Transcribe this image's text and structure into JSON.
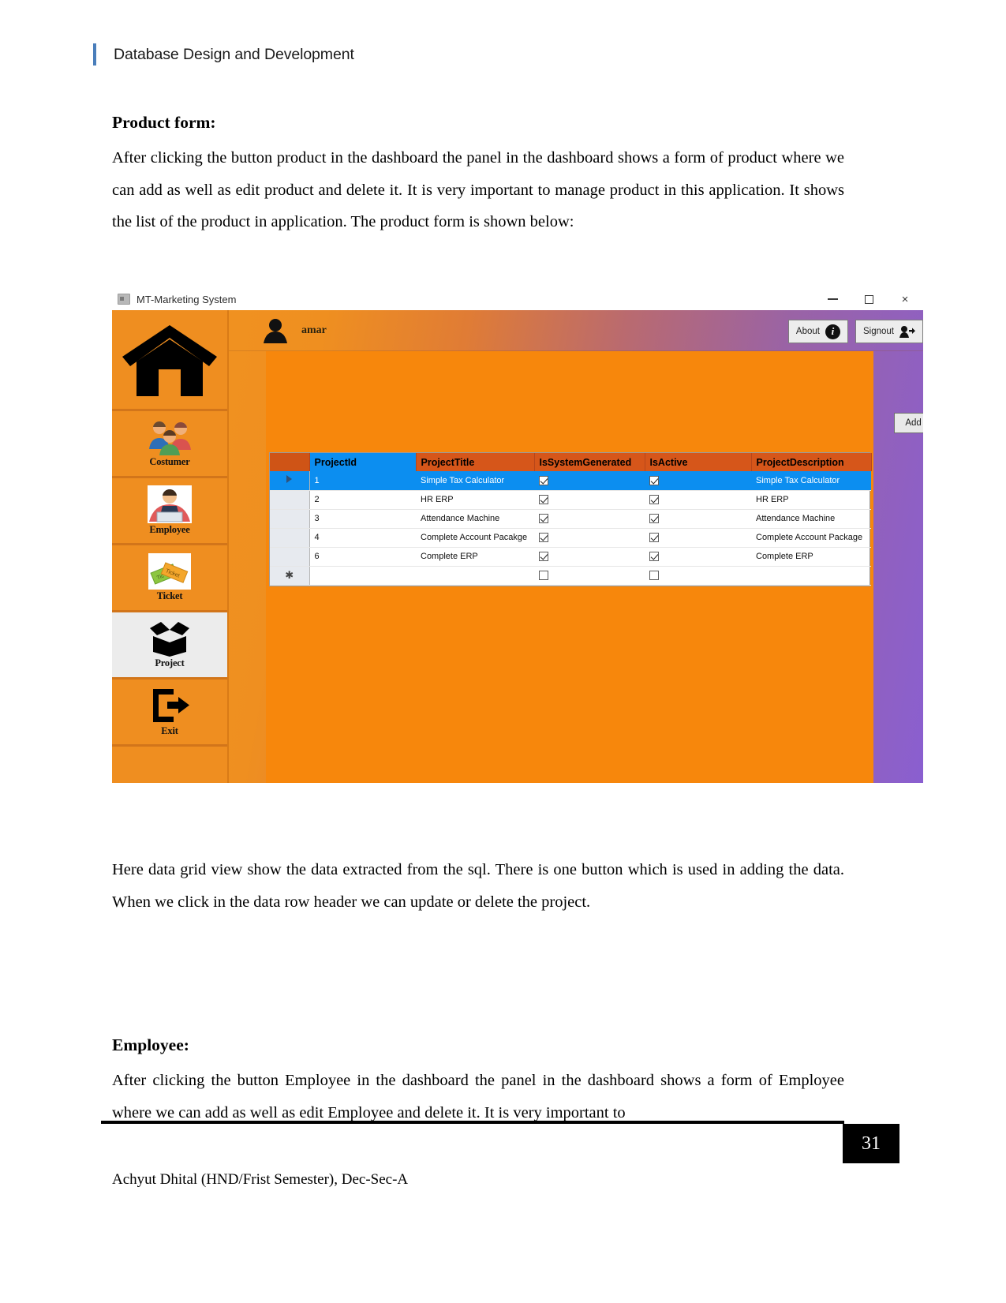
{
  "document": {
    "header_title": "Database Design and Development",
    "accent_color": "#4a7ebb",
    "page_number": "31",
    "footer_text": "Achyut Dhital (HND/Frist Semester), Dec-Sec-A"
  },
  "sections": {
    "product": {
      "heading": "Product form:",
      "paragraph": "After clicking the button product in the dashboard the panel in the dashboard shows a form of product where we can add as well as edit product and delete it. It is very important to manage product in this application. It shows the list of the product in application. The product form is shown below:"
    },
    "grid_note": {
      "paragraph": "Here data grid view show the data extracted from the sql. There is one button which is used in adding the data. When we click in the data row header we  can update or delete  the project."
    },
    "employee": {
      "heading": "Employee:",
      "paragraph": "After clicking the button Employee in the dashboard the panel in the dashboard shows a form of Employee where we can add as well as edit Employee and delete it. It is very important to"
    }
  },
  "screenshot": {
    "window": {
      "title": "MT-Marketing System",
      "icon": "app-icon",
      "minimize": "–",
      "maximize": "□",
      "close": "×"
    },
    "topbar": {
      "user_icon": "user-avatar-icon",
      "user_name": "amar",
      "about_label": "About",
      "about_icon": "info-icon",
      "signout_label": "Signout",
      "signout_icon": "signout-icon"
    },
    "sidebar": {
      "items": [
        {
          "label": "",
          "icon": "home-icon",
          "selected": false
        },
        {
          "label": "Costumer",
          "icon": "people-group-icon",
          "selected": false
        },
        {
          "label": "Employee",
          "icon": "employee-icon",
          "selected": false
        },
        {
          "label": "Ticket",
          "icon": "ticket-icon",
          "selected": false
        },
        {
          "label": "Project",
          "icon": "open-box-icon",
          "selected": true
        },
        {
          "label": "Exit",
          "icon": "exit-door-icon",
          "selected": false
        }
      ]
    },
    "panel": {
      "add_button_label": "Add New Project",
      "grid": {
        "columns": [
          "",
          "ProjectId",
          "ProjectTitle",
          "IsSystemGenerated",
          "IsActive",
          "ProjectDescription"
        ],
        "selected_column": "ProjectId",
        "rows": [
          {
            "marker": "▶",
            "ProjectId": "1",
            "ProjectTitle": "Simple Tax Calculator",
            "IsSystemGenerated": true,
            "IsActive": true,
            "ProjectDescription": "Simple Tax Calculator",
            "selected": true
          },
          {
            "marker": "",
            "ProjectId": "2",
            "ProjectTitle": "HR ERP",
            "IsSystemGenerated": true,
            "IsActive": true,
            "ProjectDescription": "HR ERP",
            "selected": false
          },
          {
            "marker": "",
            "ProjectId": "3",
            "ProjectTitle": "Attendance Machine",
            "IsSystemGenerated": true,
            "IsActive": true,
            "ProjectDescription": "Attendance Machine",
            "selected": false
          },
          {
            "marker": "",
            "ProjectId": "4",
            "ProjectTitle": "Complete Account Pacakge",
            "IsSystemGenerated": true,
            "IsActive": true,
            "ProjectDescription": "Complete Account Package",
            "selected": false
          },
          {
            "marker": "",
            "ProjectId": "6",
            "ProjectTitle": "Complete ERP",
            "IsSystemGenerated": true,
            "IsActive": true,
            "ProjectDescription": "Complete ERP",
            "selected": false
          },
          {
            "marker": "*",
            "ProjectId": "",
            "ProjectTitle": "",
            "IsSystemGenerated": false,
            "IsActive": false,
            "ProjectDescription": "",
            "selected": false
          }
        ]
      }
    },
    "colors": {
      "sidebar": "#ef8e20",
      "panel": "#f7870c",
      "header_row": "#d6561a",
      "selected": "#0c8ef0"
    }
  }
}
